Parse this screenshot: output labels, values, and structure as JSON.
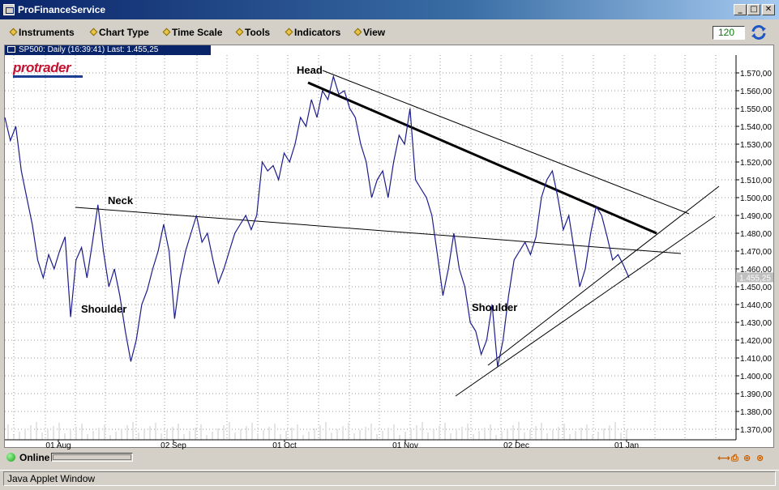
{
  "window": {
    "title": "ProFinanceService",
    "buttons": [
      "_",
      "□",
      "✕"
    ]
  },
  "menu": [
    "Instruments",
    "Chart Type",
    "Time Scale",
    "Tools",
    "Indicators",
    "View"
  ],
  "interval_value": "120",
  "chart_tab": "SP500: Daily (16:39:41) Last: 1.455,25",
  "logo": "protrader",
  "chart_data": {
    "type": "line",
    "price_axis": {
      "ylim": [
        1365,
        1575
      ],
      "ticks": [
        "1.570,00",
        "1.560,00",
        "1.550,00",
        "1.540,00",
        "1.530,00",
        "1.520,00",
        "1.510,00",
        "1.500,00",
        "1.490,00",
        "1.480,00",
        "1.470,00",
        "1.460,00",
        "1.450,00",
        "1.440,00",
        "1.430,00",
        "1.420,00",
        "1.410,00",
        "1.400,00",
        "1.390,00",
        "1.380,00",
        "1.370,00"
      ],
      "last_price_label": "1.455,25",
      "last_price": 1455.25
    },
    "x_ticks": [
      "01 Aug",
      "02 Sep",
      "01 Oct",
      "01 Nov",
      "02 Dec",
      "01 Jan"
    ],
    "annotations": [
      "Head",
      "Neck",
      "Shoulder",
      "Shoulder"
    ],
    "close_series_approx": [
      1545,
      1532,
      1540,
      1515,
      1500,
      1485,
      1465,
      1455,
      1468,
      1460,
      1470,
      1478,
      1433,
      1465,
      1472,
      1455,
      1475,
      1496,
      1470,
      1450,
      1460,
      1445,
      1425,
      1408,
      1420,
      1440,
      1448,
      1460,
      1470,
      1485,
      1470,
      1432,
      1455,
      1470,
      1480,
      1490,
      1475,
      1480,
      1465,
      1452,
      1460,
      1470,
      1480,
      1485,
      1490,
      1482,
      1490,
      1520,
      1515,
      1518,
      1510,
      1525,
      1520,
      1530,
      1545,
      1540,
      1555,
      1545,
      1560,
      1555,
      1568,
      1558,
      1560,
      1550,
      1545,
      1530,
      1520,
      1500,
      1510,
      1515,
      1500,
      1520,
      1535,
      1530,
      1550,
      1510,
      1505,
      1500,
      1490,
      1468,
      1445,
      1460,
      1480,
      1460,
      1450,
      1430,
      1425,
      1412,
      1420,
      1440,
      1405,
      1420,
      1445,
      1465,
      1470,
      1475,
      1468,
      1478,
      1500,
      1510,
      1515,
      1500,
      1482,
      1490,
      1470,
      1450,
      1460,
      1480,
      1495,
      1490,
      1478,
      1465,
      1468,
      1462,
      1455
    ]
  },
  "status": {
    "online_label": "Online",
    "tool_icons": [
      "zoom-icon",
      "print-icon",
      "add-icon",
      "close-icon"
    ]
  },
  "applet_label": "Java Applet Window"
}
